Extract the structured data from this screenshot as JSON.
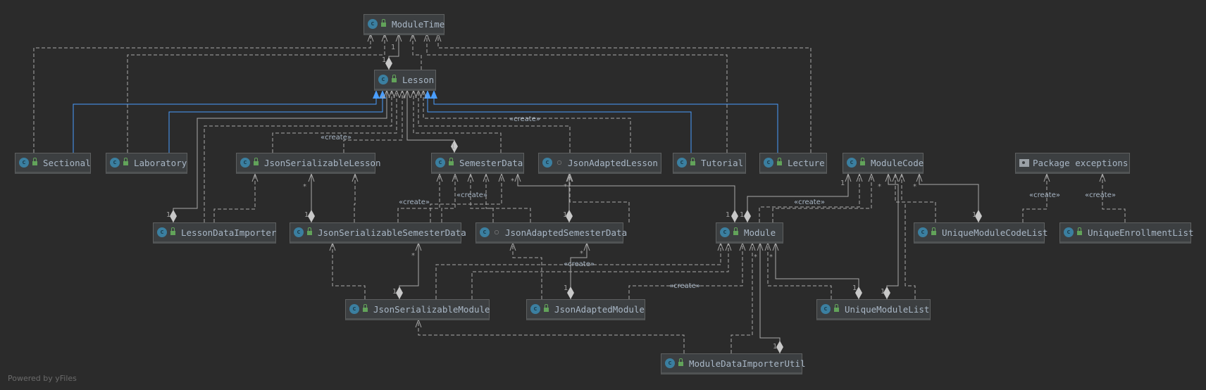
{
  "diagram": {
    "nodes": [
      {
        "name": "ModuleTime",
        "kind": "class",
        "visibility": "public"
      },
      {
        "name": "Lesson",
        "kind": "class",
        "visibility": "public"
      },
      {
        "name": "Sectional",
        "kind": "class",
        "visibility": "public"
      },
      {
        "name": "Laboratory",
        "kind": "class",
        "visibility": "public"
      },
      {
        "name": "JsonSerializableLesson",
        "kind": "class",
        "visibility": "public"
      },
      {
        "name": "SemesterData",
        "kind": "class",
        "visibility": "public"
      },
      {
        "name": "JsonAdaptedLesson",
        "kind": "class",
        "visibility": "package-private"
      },
      {
        "name": "Tutorial",
        "kind": "class",
        "visibility": "public"
      },
      {
        "name": "Lecture",
        "kind": "class",
        "visibility": "public"
      },
      {
        "name": "ModuleCode",
        "kind": "class",
        "visibility": "public"
      },
      {
        "name": "Package exceptions",
        "kind": "package"
      },
      {
        "name": "LessonDataImporter",
        "kind": "class",
        "visibility": "public"
      },
      {
        "name": "JsonSerializableSemesterData",
        "kind": "class",
        "visibility": "public"
      },
      {
        "name": "JsonAdaptedSemesterData",
        "kind": "class",
        "visibility": "package-private"
      },
      {
        "name": "Module",
        "kind": "class",
        "visibility": "public"
      },
      {
        "name": "UniqueModuleCodeList",
        "kind": "class",
        "visibility": "public"
      },
      {
        "name": "UniqueEnrollmentList",
        "kind": "class",
        "visibility": "public"
      },
      {
        "name": "JsonSerializableModule",
        "kind": "class",
        "visibility": "public"
      },
      {
        "name": "JsonAdaptedModule",
        "kind": "class",
        "visibility": "public"
      },
      {
        "name": "UniqueModuleList",
        "kind": "class",
        "visibility": "public"
      },
      {
        "name": "ModuleDataImporterUtil",
        "kind": "class",
        "visibility": "public"
      }
    ],
    "class_icon_letter": "c",
    "stereotype_create": "«create»",
    "mult_one": "1",
    "mult_many": "*",
    "colors": {
      "background": "#2b2b2b",
      "node": "#3c3f41",
      "text": "#a9b7c6",
      "edge": "#a8a8a8",
      "inheritance": "#4a9eff",
      "lock": "#62a35a",
      "class_icon": "#3b7fa0"
    }
  },
  "footer": {
    "powered_by": "Powered by yFiles"
  }
}
